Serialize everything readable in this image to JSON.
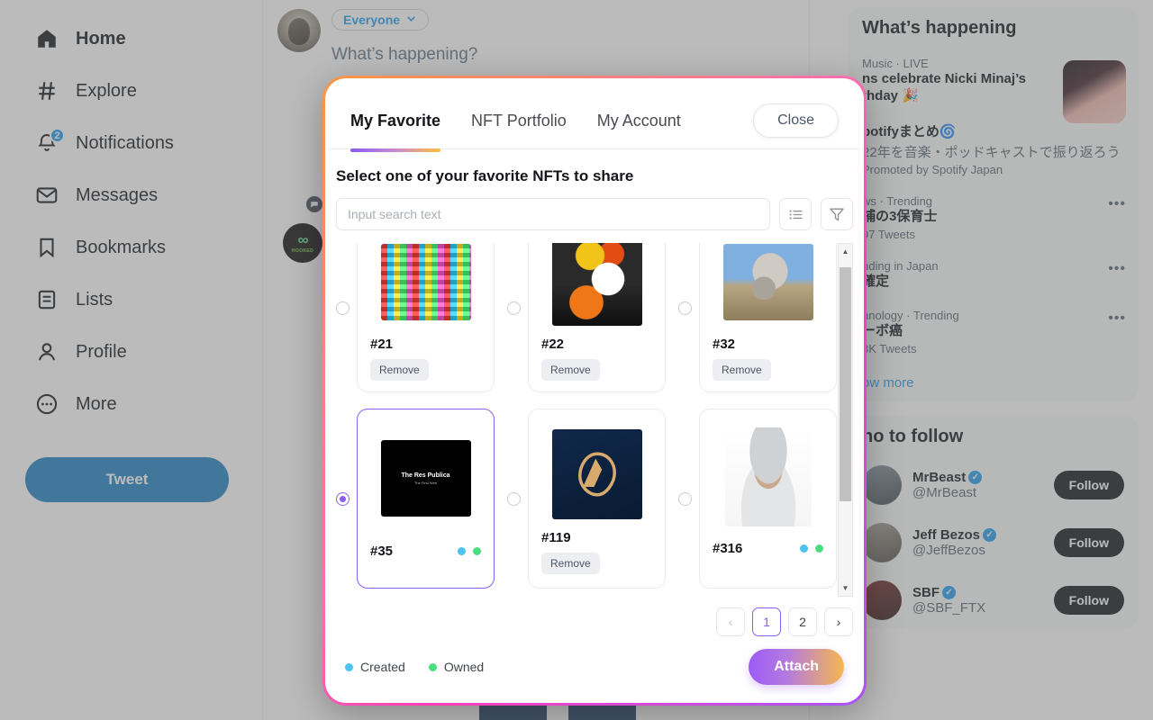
{
  "sidebar": {
    "items": [
      {
        "label": "Home",
        "icon": "home-icon",
        "active": true
      },
      {
        "label": "Explore",
        "icon": "hash-icon",
        "active": false
      },
      {
        "label": "Notifications",
        "icon": "bell-icon",
        "active": false,
        "badge": "2"
      },
      {
        "label": "Messages",
        "icon": "envelope-icon",
        "active": false
      },
      {
        "label": "Bookmarks",
        "icon": "bookmark-icon",
        "active": false
      },
      {
        "label": "Lists",
        "icon": "list-icon",
        "active": false
      },
      {
        "label": "Profile",
        "icon": "person-icon",
        "active": false
      },
      {
        "label": "More",
        "icon": "more-circle-icon",
        "active": false
      }
    ],
    "tweet_button": "Tweet"
  },
  "compose": {
    "audience": "Everyone",
    "placeholder": "What’s happening?"
  },
  "right": {
    "whats_happening": {
      "title": "What’s happening",
      "trends": [
        {
          "meta": "Music · LIVE",
          "name": "ns celebrate Nicki Minaj’s\nthday 🎉",
          "sub": "",
          "thumb": true,
          "dots": false
        },
        {
          "meta": "",
          "name": "potifyまとめ🌀",
          "sub2": "22年を音楽・ポッドキャストで振り返ろう",
          "sub": "Promoted by Spotify Japan",
          "thumb": false,
          "dots": false
        },
        {
          "meta": "ws · Trending",
          "name": "捕の3保育士",
          "sub": "97 Tweets",
          "thumb": false,
          "dots": true
        },
        {
          "meta": "nding in Japan",
          "name": "確定",
          "sub": "",
          "thumb": false,
          "dots": true
        },
        {
          "meta": "hnology · Trending",
          "name": "ーボ癌",
          "sub": "3K Tweets",
          "thumb": false,
          "dots": true
        }
      ],
      "show_more": "ow more"
    },
    "who_to_follow": {
      "title": "ho to follow",
      "people": [
        {
          "name": "MrBeast",
          "handle": "@MrBeast",
          "verified": true,
          "button": "Follow"
        },
        {
          "name": "Jeff Bezos",
          "handle": "@JeffBezos",
          "verified": true,
          "button": "Follow"
        },
        {
          "name": "SBF",
          "handle": "@SBF_FTX",
          "verified": true,
          "button": "Follow"
        }
      ]
    }
  },
  "modal": {
    "tabs": [
      {
        "label": "My Favorite",
        "active": true
      },
      {
        "label": "NFT Portfolio",
        "active": false
      },
      {
        "label": "My Account",
        "active": false
      }
    ],
    "close_label": "Close",
    "subtitle": "Select one of your favorite NFTs to share",
    "search_placeholder": "Input search text",
    "search_value": "",
    "list_icon": "list-view-icon",
    "filter_icon": "funnel-filter-icon",
    "cards": [
      {
        "title": "#21",
        "selected": false,
        "action": "Remove",
        "badges": [],
        "art": "pixel-collage"
      },
      {
        "title": "#22",
        "selected": false,
        "action": "Remove",
        "badges": [],
        "art": "cat-pumpkin"
      },
      {
        "title": "#32",
        "selected": false,
        "action": "Remove",
        "badges": [],
        "art": "cat-field"
      },
      {
        "title": "#35",
        "selected": true,
        "action": "",
        "badges": [
          "created",
          "owned"
        ],
        "art": "res-publica"
      },
      {
        "title": "#119",
        "selected": false,
        "action": "Remove",
        "badges": [],
        "art": "blue-logo"
      },
      {
        "title": "#316",
        "selected": false,
        "action": "",
        "badges": [
          "created",
          "owned"
        ],
        "art": "philosopher"
      }
    ],
    "card_art_labels": {
      "res_publica_title": "The Res Publica",
      "res_publica_sub": "The First Web"
    },
    "pagination": {
      "prev": "‹",
      "next": "›",
      "pages": [
        "1",
        "2"
      ],
      "current": "1"
    },
    "legend": [
      {
        "label": "Created",
        "color": "#4cc3f0"
      },
      {
        "label": "Owned",
        "color": "#4ade80"
      }
    ],
    "attach_label": "Attach"
  },
  "colors": {
    "accent_purple": "#8b5cf6",
    "accent_orange": "#f6b74f",
    "accent_pink": "#ff3fb4",
    "twitter_blue": "#1d9bf0",
    "created_dot": "#4cc3f0",
    "owned_dot": "#4ade80"
  }
}
